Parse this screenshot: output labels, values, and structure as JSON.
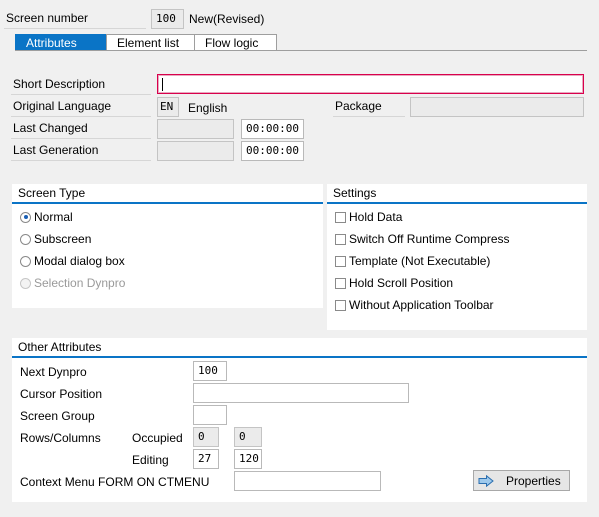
{
  "header": {
    "screen_number_label": "Screen number",
    "screen_number_value": "100",
    "status": "New(Revised)"
  },
  "tabs": [
    {
      "label": "Attributes",
      "active": true
    },
    {
      "label": "Element list",
      "active": false
    },
    {
      "label": "Flow logic",
      "active": false
    }
  ],
  "attributes": {
    "short_description_label": "Short Description",
    "short_description_value": "",
    "original_language_label": "Original Language",
    "original_language_code": "EN",
    "original_language_name": "English",
    "package_label": "Package",
    "package_value": "",
    "last_changed_label": "Last Changed",
    "last_changed_date": "",
    "last_changed_time": "00:00:00",
    "last_generation_label": "Last Generation",
    "last_generation_date": "",
    "last_generation_time": "00:00:00"
  },
  "screen_type": {
    "title": "Screen Type",
    "options": [
      {
        "label": "Normal",
        "selected": true,
        "disabled": false
      },
      {
        "label": "Subscreen",
        "selected": false,
        "disabled": false
      },
      {
        "label": "Modal dialog box",
        "selected": false,
        "disabled": false
      },
      {
        "label": "Selection Dynpro",
        "selected": false,
        "disabled": true
      }
    ]
  },
  "settings": {
    "title": "Settings",
    "options": [
      {
        "label": "Hold Data",
        "checked": false
      },
      {
        "label": "Switch Off Runtime Compress",
        "checked": false
      },
      {
        "label": "Template (Not Executable)",
        "checked": false
      },
      {
        "label": "Hold Scroll Position",
        "checked": false
      },
      {
        "label": "Without Application Toolbar",
        "checked": false
      }
    ]
  },
  "other_attributes": {
    "title": "Other Attributes",
    "next_dynpro_label": "Next Dynpro",
    "next_dynpro_value": "100",
    "cursor_position_label": "Cursor Position",
    "cursor_position_value": "",
    "screen_group_label": "Screen Group",
    "screen_group_value": "",
    "rows_columns_label": "Rows/Columns",
    "occupied_label": "Occupied",
    "occupied_rows": "0",
    "occupied_cols": "0",
    "editing_label": "Editing",
    "editing_rows": "27",
    "editing_cols": "120",
    "context_menu_label": "Context Menu FORM ON CTMENU",
    "context_menu_value": "",
    "properties_button": "Properties",
    "properties_icon": "arrow-right-icon"
  },
  "colors": {
    "accent": "#0a74c6",
    "background": "#f0f0f0",
    "focus": "#d9004c"
  }
}
